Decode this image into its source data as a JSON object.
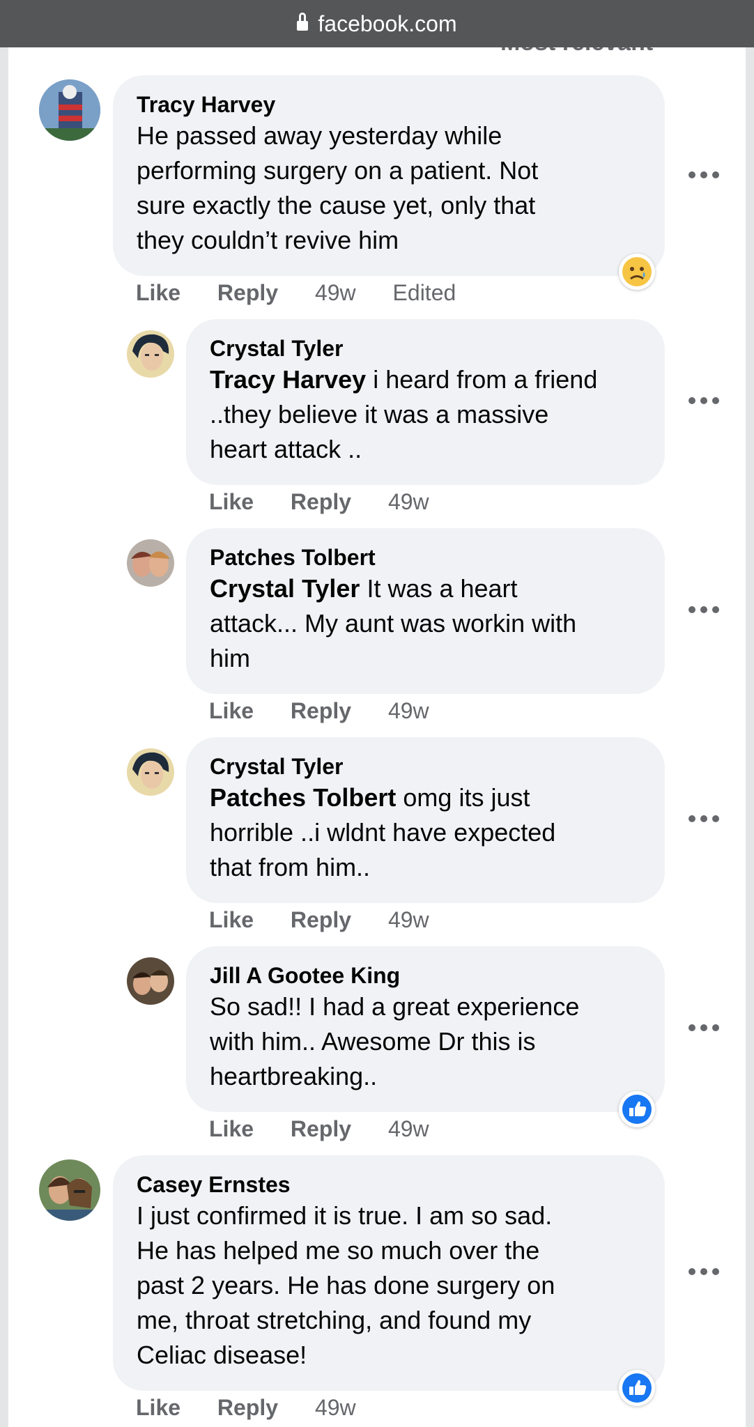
{
  "browser": {
    "url": "facebook.com"
  },
  "sort_label": "Most relevant",
  "comments": [
    {
      "author": "Tracy Harvey",
      "tag": "",
      "text_lines": [
        "He passed away yesterday while",
        "performing surgery on a patient. Not",
        "sure exactly the cause yet, only that",
        "they couldn’t revive him"
      ],
      "like": "Like",
      "reply": "Reply",
      "time": "49w",
      "edited": "Edited",
      "reaction": "sad-reaction-icon"
    },
    {
      "author": "Crystal Tyler",
      "tag": "Tracy Harvey",
      "text_lines": [
        " i heard from a friend",
        "..they believe it was a massive",
        "heart attack .."
      ],
      "like": "Like",
      "reply": "Reply",
      "time": "49w"
    },
    {
      "author": "Patches Tolbert",
      "tag": "Crystal Tyler",
      "text_lines": [
        " It was a heart",
        "attack... My aunt was workin with",
        "him"
      ],
      "like": "Like",
      "reply": "Reply",
      "time": "49w"
    },
    {
      "author": "Crystal Tyler",
      "tag": "Patches Tolbert",
      "text_lines": [
        " omg its just",
        "horrible ..i wldnt have expected",
        "that from him.."
      ],
      "like": "Like",
      "reply": "Reply",
      "time": "49w"
    },
    {
      "author": "Jill A Gootee King",
      "tag": "",
      "text_lines": [
        "So sad!! I had a great experience",
        "with him.. Awesome Dr this is",
        "heartbreaking.."
      ],
      "like": "Like",
      "reply": "Reply",
      "time": "49w",
      "reaction": "like-reaction-icon"
    },
    {
      "author": "Casey Ernstes",
      "tag": "",
      "text_lines": [
        "I just confirmed it is true. I am so sad.",
        "He has helped me so much over the",
        "past 2 years. He has done surgery on",
        "me, throat stretching, and found my",
        "Celiac disease!"
      ],
      "like": "Like",
      "reply": "Reply",
      "time": "49w",
      "reaction": "like-reaction-icon"
    }
  ],
  "colors": {
    "bubble": "#f0f2f5",
    "meta": "#65676b",
    "like_blue": "#1877f2",
    "urlbar": "#555658"
  }
}
